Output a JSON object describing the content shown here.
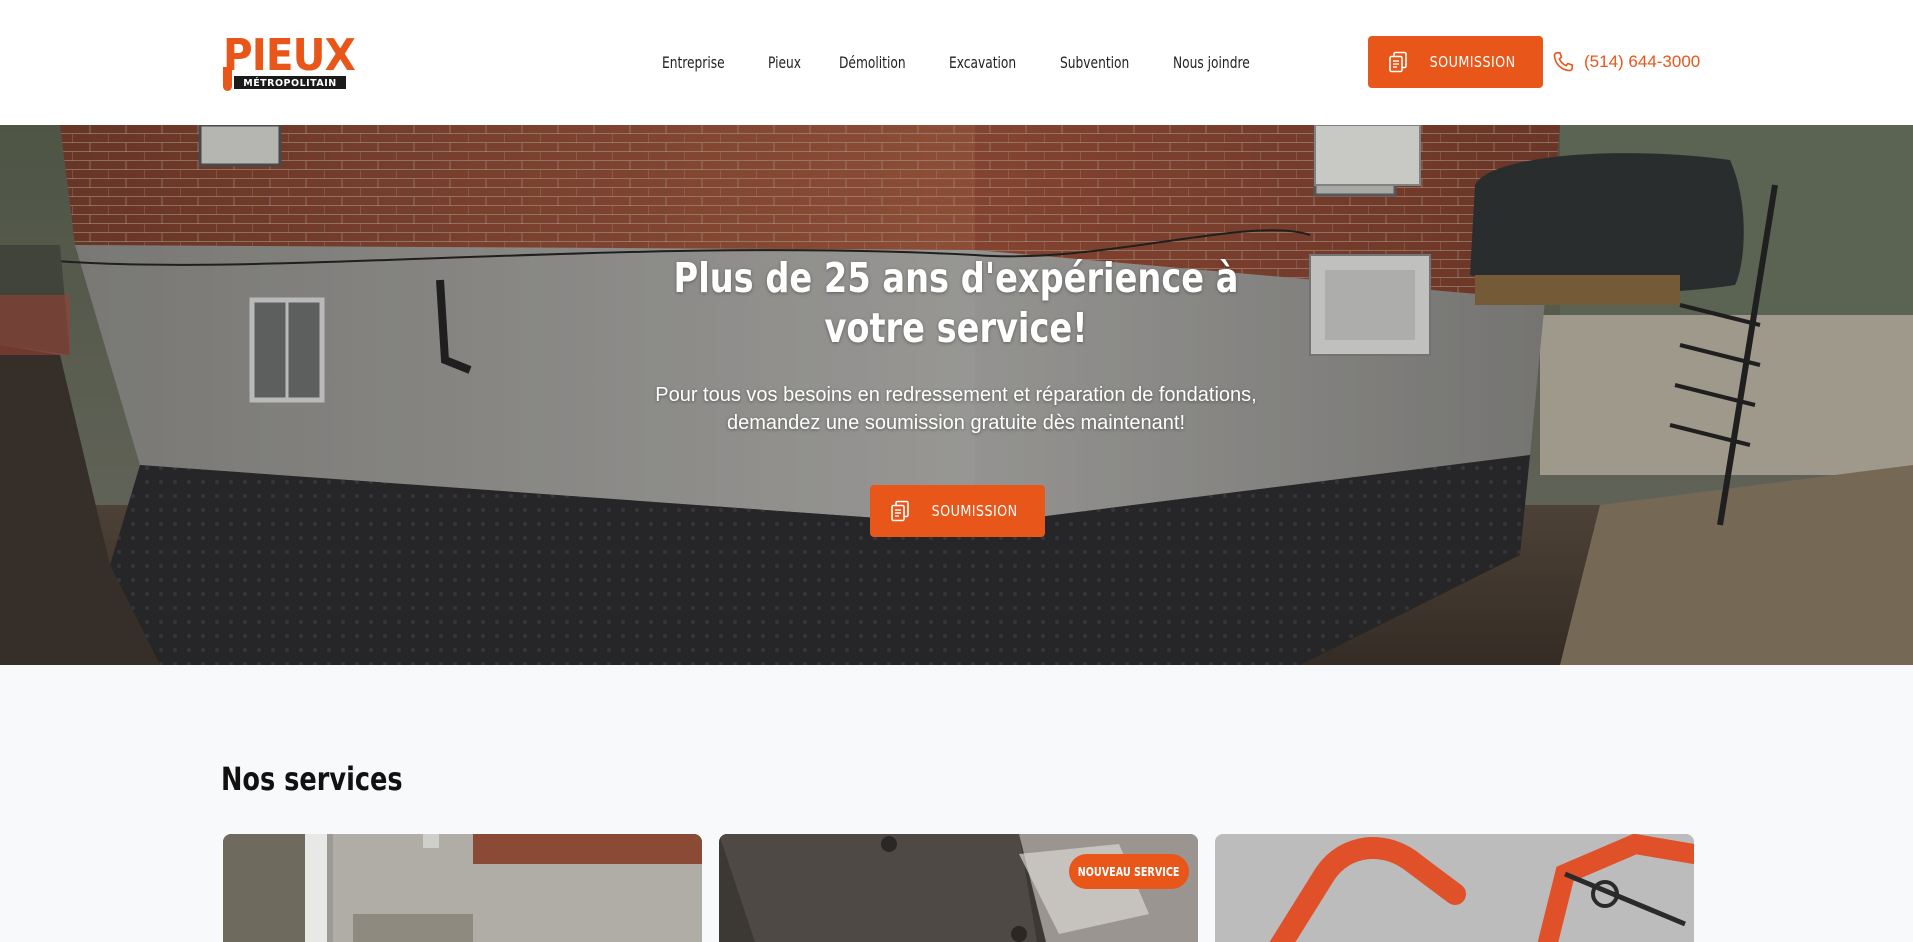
{
  "brand": {
    "logo_main": "PIEUX",
    "logo_sub": "MÉTROPOLITAIN",
    "accent_color": "#e8561a"
  },
  "nav": {
    "items": [
      {
        "label": "Entreprise"
      },
      {
        "label": "Pieux"
      },
      {
        "label": "Démolition"
      },
      {
        "label": "Excavation"
      },
      {
        "label": "Subvention"
      },
      {
        "label": "Nous joindre"
      }
    ]
  },
  "header": {
    "quote_button": {
      "label": "SOUMISSION",
      "icon": "document-icon"
    },
    "phone": {
      "number": "(514) 644-3000",
      "icon": "phone-icon"
    }
  },
  "hero": {
    "title": "Plus de 25 ans d'expérience à votre service!",
    "subtitle": "Pour tous vos besoins en redressement et réparation de fondations, demandez une soumission gratuite dès maintenant!",
    "button": {
      "label": "SOUMISSION",
      "icon": "document-icon"
    }
  },
  "services": {
    "title": "Nos services",
    "cards": [
      {
        "image": "foundation-wall-photo"
      },
      {
        "image": "pile-photo",
        "badge": "NOUVEAU SERVICE"
      },
      {
        "image": "excavator-photo"
      }
    ]
  }
}
